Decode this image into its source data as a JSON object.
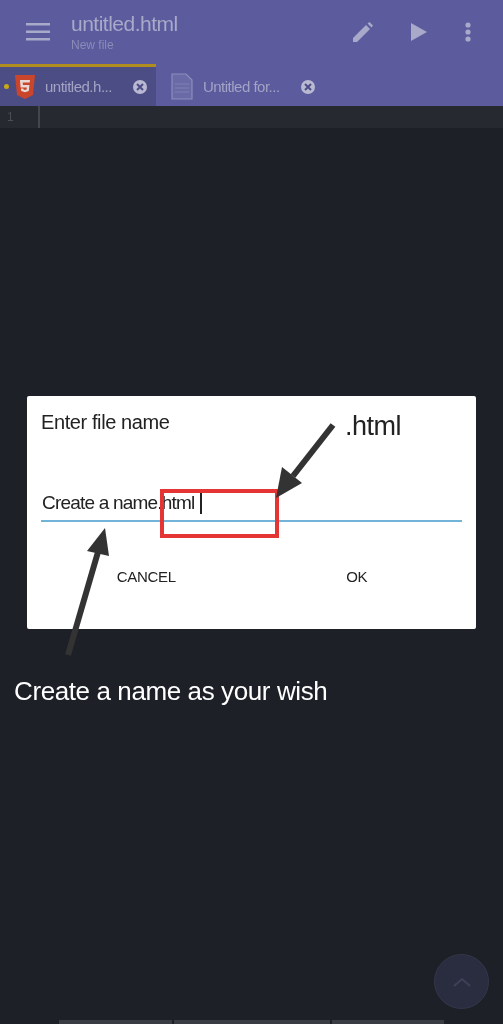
{
  "app_bar": {
    "title": "untitled.html",
    "subtitle": "New file"
  },
  "tabs": [
    {
      "label": "untitled.h...",
      "kind": "html",
      "modified": true,
      "selected": true
    },
    {
      "label": "Untitled for...",
      "kind": "text",
      "modified": false,
      "selected": false
    }
  ],
  "editor": {
    "line_numbers": [
      "1"
    ]
  },
  "dialog": {
    "title": "Enter file name",
    "value": "Create a name.html",
    "buttons": [
      "CANCEL",
      "OK"
    ]
  },
  "annotations": [
    {
      "kind": "label",
      "text": ".html"
    },
    {
      "kind": "caption",
      "text": "Create a name as your wish"
    }
  ]
}
